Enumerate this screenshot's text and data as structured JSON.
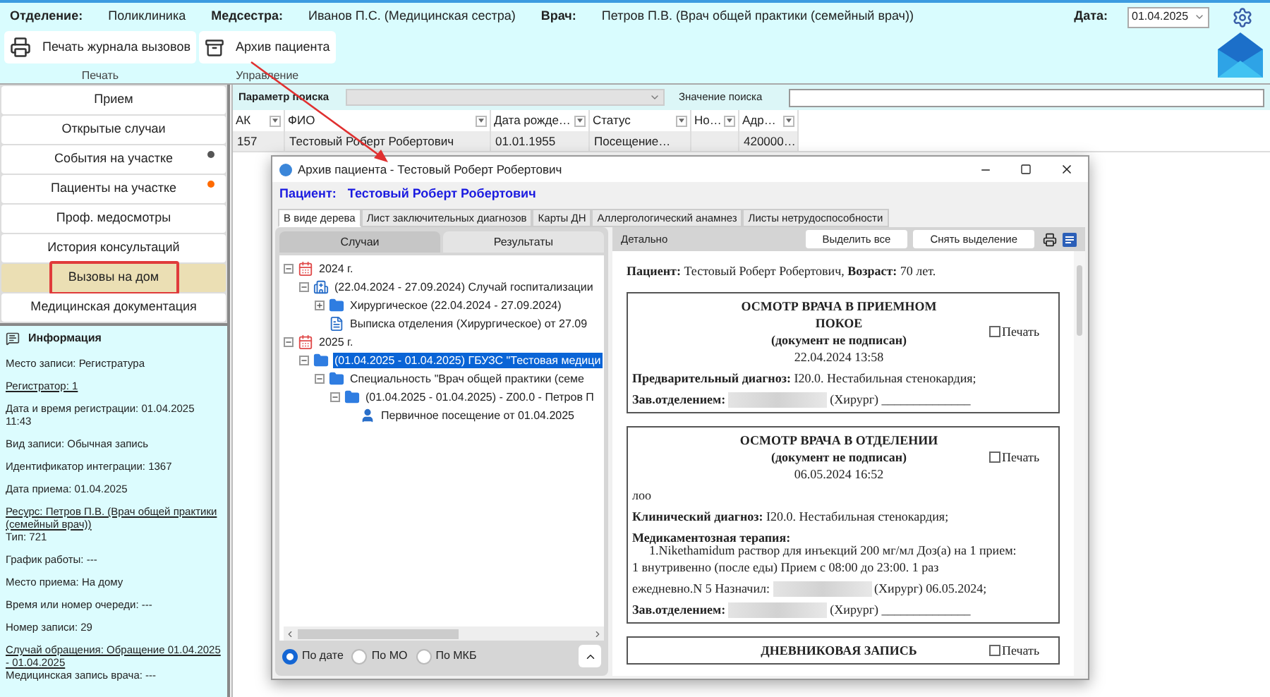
{
  "header": {
    "fields": [
      {
        "label": "Отделение:",
        "value": "Поликлиника"
      },
      {
        "label": "Медсестра:",
        "value": "Иванов П.С. (Медицинская сестра)"
      },
      {
        "label": "Врач:",
        "value": "Петров П.В. (Врач общей практики (семейный врач))"
      }
    ],
    "date": {
      "label": "Дата:",
      "value": "01.04.2025"
    }
  },
  "ribbon": [
    {
      "label": "Печать",
      "buttons": [
        {
          "label": "Печать журнала вызовов",
          "kind": "print"
        }
      ]
    },
    {
      "label": "Управление",
      "buttons": [
        {
          "label": "Архив пациента",
          "kind": "archive"
        }
      ]
    }
  ],
  "nav": [
    {
      "label": "Прием",
      "selected": false,
      "marked": false
    },
    {
      "label": "Открытые случаи",
      "selected": false,
      "marked": false
    },
    {
      "label": "События на участке",
      "selected": false,
      "marked": false,
      "color": "#555555"
    },
    {
      "label": "Пациенты на участке",
      "selected": false,
      "marked": false,
      "color": "#ff6a00"
    },
    {
      "label": "Проф. медосмотры",
      "selected": false,
      "marked": false
    },
    {
      "label": "История консультаций",
      "selected": false,
      "marked": false
    },
    {
      "label": "Вызовы на дом",
      "selected": true,
      "marked": true
    },
    {
      "label": "Медицинская документация",
      "selected": false,
      "marked": false
    }
  ],
  "info": {
    "title": "Информация",
    "entries": [
      {
        "lines": [
          {
            "text": "Место записи: Регистратура",
            "link": false
          }
        ]
      },
      {
        "lines": [
          {
            "text": "Регистратор: 1",
            "link": true
          }
        ]
      },
      {
        "lines": [
          {
            "text": "Дата и время регистрации: 01.04.2025 11:43",
            "link": false
          }
        ]
      },
      {
        "lines": [
          {
            "text": "Вид записи: Обычная запись",
            "link": false
          }
        ]
      },
      {
        "lines": [
          {
            "text": "Идентификатор интеграции: 1367",
            "link": false
          }
        ]
      },
      {
        "lines": [
          {
            "text": "Дата приема: 01.04.2025",
            "link": false
          }
        ]
      },
      {
        "lines": [
          {
            "text": "Ресурс: Петров П.В. (Врач общей практики (семейный врач))",
            "link": true
          },
          {
            "text": "Тип: 721",
            "link": false
          }
        ]
      },
      {
        "lines": [
          {
            "text": "График работы: ---",
            "link": false
          }
        ]
      },
      {
        "lines": [
          {
            "text": "Место приема: На дому",
            "link": false
          }
        ]
      },
      {
        "lines": [
          {
            "text": "Время или номер очереди: ---",
            "link": false
          }
        ]
      },
      {
        "lines": [
          {
            "text": "Номер записи: 29",
            "link": false
          }
        ]
      },
      {
        "lines": [
          {
            "text": "Случай обращения: Обращение 01.04.2025 - 01.04.2025",
            "link": true
          },
          {
            "text": "Медицинская запись врача: ---",
            "link": false
          }
        ]
      }
    ]
  },
  "search": {
    "param_label": "Параметр поиска",
    "value_label": "Значение поиска"
  },
  "table": {
    "columns": [
      "АК",
      "ФИО",
      "Дата рожде…",
      "Статус",
      "Но…",
      "Адр…"
    ],
    "rows": [
      {
        "cells": [
          "157",
          "Тестовый Роберт Робертович",
          "01.01.1955",
          "Посещение…",
          null,
          "420000…"
        ],
        "selected": true
      }
    ]
  },
  "dialog": {
    "title": "Архив пациента - Тестовый Роберт Робертович",
    "patient_label": "Пациент:",
    "patient_name": "Тестовый Роберт Робертович",
    "tabs": [
      {
        "label": "В виде дерева",
        "selected": true
      },
      {
        "label": "Лист заключительных диагнозов",
        "selected": false
      },
      {
        "label": "Карты ДН",
        "selected": false
      },
      {
        "label": "Аллергологический анамнез",
        "selected": false
      },
      {
        "label": "Листы нетрудоспособности",
        "selected": false
      }
    ],
    "left_tabs": [
      {
        "label": "Случаи",
        "selected": true
      },
      {
        "label": "Результаты",
        "selected": false
      }
    ],
    "tree": [
      {
        "label": "2024 г.",
        "kind": "calendar",
        "expanded": true,
        "selected": false,
        "children": [
          {
            "label": "(22.04.2024 - 27.09.2024) Случай госпитализации",
            "kind": "hospital",
            "expanded": true,
            "selected": false,
            "children": [
              {
                "label": "Хирургическое (22.04.2024 - 27.09.2024)",
                "kind": "folder",
                "expanded": false,
                "selected": false
              },
              {
                "label": "Выписка отделения (Хирургическое) от 27.09",
                "kind": "document",
                "selected": false
              }
            ]
          }
        ]
      },
      {
        "label": "2025 г.",
        "kind": "calendar",
        "expanded": true,
        "selected": false,
        "children": [
          {
            "label": "(01.04.2025 - 01.04.2025) ГБУЗС \"Тестовая медици",
            "kind": "folder",
            "expanded": true,
            "selected": true,
            "children": [
              {
                "label": "Специальность \"Врач общей практики (семе",
                "kind": "folder",
                "expanded": true,
                "selected": false,
                "children": [
                  {
                    "label": "(01.04.2025 - 01.04.2025) - Z00.0 - Петров П",
                    "kind": "folder",
                    "expanded": true,
                    "selected": false,
                    "children": [
                      {
                        "label": "Первичное посещение от 01.04.2025",
                        "kind": "person",
                        "selected": false
                      }
                    ]
                  }
                ]
              }
            ]
          }
        ]
      }
    ],
    "sort_options": [
      {
        "label": "По дате",
        "selected": true
      },
      {
        "label": "По МО",
        "selected": false
      },
      {
        "label": "По МКБ",
        "selected": false
      }
    ],
    "detail_label": "Детально",
    "detail_buttons": [
      "Выделить все",
      "Снять выделение"
    ],
    "document": {
      "summary": "**Пациент:** Тестовый Роберт Робертович, **Возраст:** 70 лет.",
      "records": [
        {
          "title": "ОСМОТР ВРАЧА В ПРИЕМНОМ ПОКОЕ",
          "status": "(документ не подписан)",
          "datetime": "22.04.2024 13:58",
          "print_label": "Печать",
          "print_checked": false,
          "lines": [
            {
              "kind": "text",
              "text": "**Предварительный диагноз:** I20.0. Нестабильная стенокардия;"
            },
            {
              "kind": "signature",
              "before": "**Зав.отделением:**",
              "after": "(Хирург) ______________"
            }
          ]
        },
        {
          "title": "ОСМОТР ВРАЧА В ОТДЕЛЕНИИ",
          "status": "(документ не подписан)",
          "datetime": "06.05.2024 16:52",
          "print_label": "Печать",
          "print_checked": false,
          "lines": [
            {
              "kind": "text",
              "text": "лоо"
            },
            {
              "kind": "text",
              "text": "**Клинический диагноз:** I20.0. Нестабильная стенокардия;"
            },
            {
              "kind": "heading",
              "text": "Медикаментозная терапия:"
            },
            {
              "kind": "item",
              "text": "1.Nikethamidum раствор для инъекций 200 мг/мл Доз(а) на 1 прием:"
            },
            {
              "kind": "continuation",
              "text": "1 внутривенно (после еды) Прием с 08:00 до 23:00. 1 раз"
            },
            {
              "kind": "signature",
              "before": "ежедневно.N 5 Назначил:",
              "after": "(Хирург) 06.05.2024;"
            },
            {
              "kind": "signature",
              "before": "**Зав.отделением:**",
              "after": "(Хирург) ______________"
            }
          ]
        },
        {
          "title": "ДНЕВНИКОВАЯ ЗАПИСЬ",
          "print_label": "Печать",
          "print_checked": false
        }
      ]
    }
  }
}
